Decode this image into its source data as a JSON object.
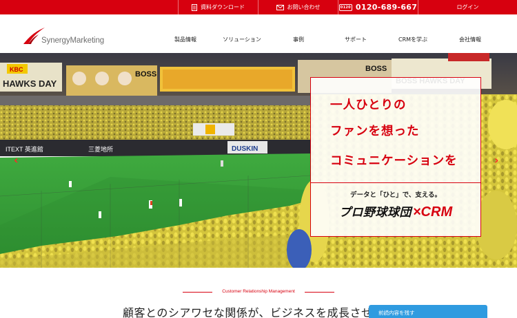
{
  "topbar": {
    "download_label": "資料ダウンロード",
    "contact_label": "お問い合わせ",
    "phone_badge": "0120",
    "phone_number": "0120-689-667",
    "login_label": "ログイン",
    "accent_color": "#d7000f"
  },
  "header": {
    "logo_text": "SynergyMarketing",
    "nav": [
      {
        "label": "製品情報"
      },
      {
        "label": "ソリューション"
      },
      {
        "label": "事例"
      },
      {
        "label": "サポート"
      },
      {
        "label": "CRMを学ぶ"
      },
      {
        "label": "会社情報"
      }
    ]
  },
  "hero": {
    "headline_lines": [
      "一人ひとりの",
      "ファンを想った",
      "コミュニケーションを"
    ],
    "subcopy": "データと「ひと」で、支える。",
    "brand_jp": "プロ野球球団",
    "brand_crm": "×CRM",
    "prev_icon": "chevron-left-icon",
    "next_icon": "chevron-right-icon",
    "stadium_banners": [
      "HAWKS DAY",
      "BOSS",
      "BOSS",
      "BOSS HAWKS DAY",
      "DUSKIN",
      "KBC"
    ]
  },
  "section": {
    "label": "Customer Relationship Management",
    "title": "顧客とのシアワセな関係が、ビジネスを成長させ"
  },
  "floating": {
    "save_label": "前読内容を残す"
  }
}
